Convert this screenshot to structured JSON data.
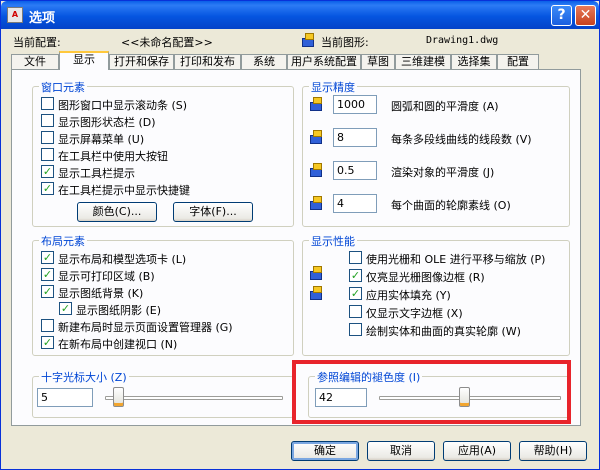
{
  "window": {
    "title": "选项",
    "app_icon": "A",
    "help_glyph": "?",
    "close_glyph": "✕"
  },
  "header": {
    "current_profile_label": "当前配置:",
    "current_profile_value": "<<未命名配置>>",
    "current_drawing_label": "当前图形:",
    "current_drawing_value": "Drawing1.dwg"
  },
  "tabs": [
    "文件",
    "显示",
    "打开和保存",
    "打印和发布",
    "系统",
    "用户系统配置",
    "草图",
    "三维建模",
    "选择集",
    "配置"
  ],
  "active_tab_index": 1,
  "window_elements": {
    "title": "窗口元素",
    "items": [
      {
        "label": "图形窗口中显示滚动条 (S)",
        "checked": false
      },
      {
        "label": "显示图形状态栏 (D)",
        "checked": false
      },
      {
        "label": "显示屏幕菜单 (U)",
        "checked": false
      },
      {
        "label": "在工具栏中使用大按钮",
        "checked": false
      },
      {
        "label": "显示工具栏提示",
        "checked": true
      },
      {
        "label": "在工具栏提示中显示快捷键",
        "checked": true
      }
    ],
    "colors_button": "颜色(C)...",
    "fonts_button": "字体(F)..."
  },
  "layout_elements": {
    "title": "布局元素",
    "items": [
      {
        "label": "显示布局和模型选项卡 (L)",
        "checked": true
      },
      {
        "label": "显示可打印区域 (B)",
        "checked": true
      },
      {
        "label": "显示图纸背景 (K)",
        "checked": true
      },
      {
        "label": "显示图纸阴影 (E)",
        "checked": true
      },
      {
        "label": "新建布局时显示页面设置管理器 (G)",
        "checked": false
      },
      {
        "label": "在新布局中创建视口 (N)",
        "checked": true
      }
    ]
  },
  "crosshair": {
    "title": "十字光标大小 (Z)",
    "value": "5",
    "slider_fraction": 0.05
  },
  "display_resolution": {
    "title": "显示精度",
    "items": [
      {
        "value": "1000",
        "label": "圆弧和圆的平滑度 (A)"
      },
      {
        "value": "8",
        "label": "每条多段线曲线的线段数 (V)"
      },
      {
        "value": "0.5",
        "label": "渲染对象的平滑度 (J)"
      },
      {
        "value": "4",
        "label": "每个曲面的轮廓素线 (O)"
      }
    ]
  },
  "display_performance": {
    "title": "显示性能",
    "items": [
      {
        "label": "使用光栅和 OLE 进行平移与缩放 (P)",
        "checked": false
      },
      {
        "label": "仅亮显光栅图像边框 (R)",
        "checked": true
      },
      {
        "label": "应用实体填充 (Y)",
        "checked": true
      },
      {
        "label": "仅显示文字边框 (X)",
        "checked": false
      },
      {
        "label": "绘制实体和曲面的真实轮廓 (W)",
        "checked": false
      }
    ]
  },
  "xref_fading": {
    "title": "参照编辑的褪色度 (I)",
    "value": "42",
    "slider_fraction": 0.47
  },
  "footer": {
    "ok": "确定",
    "cancel": "取消",
    "apply": "应用(A)",
    "help": "帮助(H)"
  },
  "colors": {
    "title_bar": "#0555E0",
    "group_title": "#0046D5",
    "highlight": "#E8242B",
    "check": "#21A121"
  }
}
